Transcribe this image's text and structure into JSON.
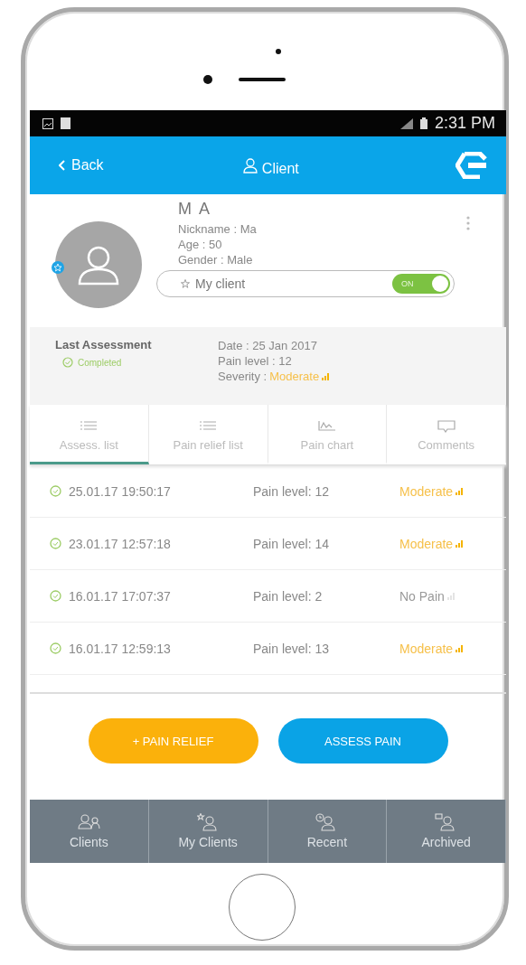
{
  "status_bar": {
    "time": "2:31 PM"
  },
  "header": {
    "back": "Back",
    "title": "Client"
  },
  "profile": {
    "name": "M  A",
    "nickname": "Nickname : Ma",
    "age": "Age : 50",
    "gender": "Gender : Male",
    "my_client": {
      "label": "My client",
      "on": true,
      "toggle_label": "ON"
    }
  },
  "last_assessment": {
    "heading": "Last Assessment",
    "status": "Completed",
    "date": "Date : 25 Jan 2017",
    "pain_level": "Pain level : 12",
    "severity": {
      "label": "Severity :",
      "value": "Moderate",
      "kind": "moderate"
    }
  },
  "tabs": [
    {
      "label": "Assess. list",
      "kind": "list",
      "selected": true
    },
    {
      "label": "Pain relief list",
      "kind": "list",
      "selected": false
    },
    {
      "label": "Pain chart",
      "kind": "chart",
      "selected": false
    },
    {
      "label": "Comments",
      "kind": "comments",
      "selected": false
    }
  ],
  "assessments": [
    {
      "time": "25.01.17 19:50:17",
      "pain": "Pain level: 12",
      "severity": "Moderate",
      "kind": "moderate"
    },
    {
      "time": "23.01.17 12:57:18",
      "pain": "Pain level: 14",
      "severity": "Moderate",
      "kind": "moderate"
    },
    {
      "time": "16.01.17 17:07:37",
      "pain": "Pain level: 2",
      "severity": "No Pain",
      "kind": "none"
    },
    {
      "time": "16.01.17 12:59:13",
      "pain": "Pain level: 13",
      "severity": "Moderate",
      "kind": "moderate"
    }
  ],
  "buttons": [
    {
      "label": "+ PAIN RELIEF",
      "kind": "relief"
    },
    {
      "label": "ASSESS PAIN",
      "kind": "assess"
    }
  ],
  "nav": [
    {
      "label": "Clients",
      "kind": "clients"
    },
    {
      "label": "My Clients",
      "kind": "my"
    },
    {
      "label": "Recent",
      "kind": "recent"
    },
    {
      "label": "Archived",
      "kind": "archived"
    }
  ]
}
